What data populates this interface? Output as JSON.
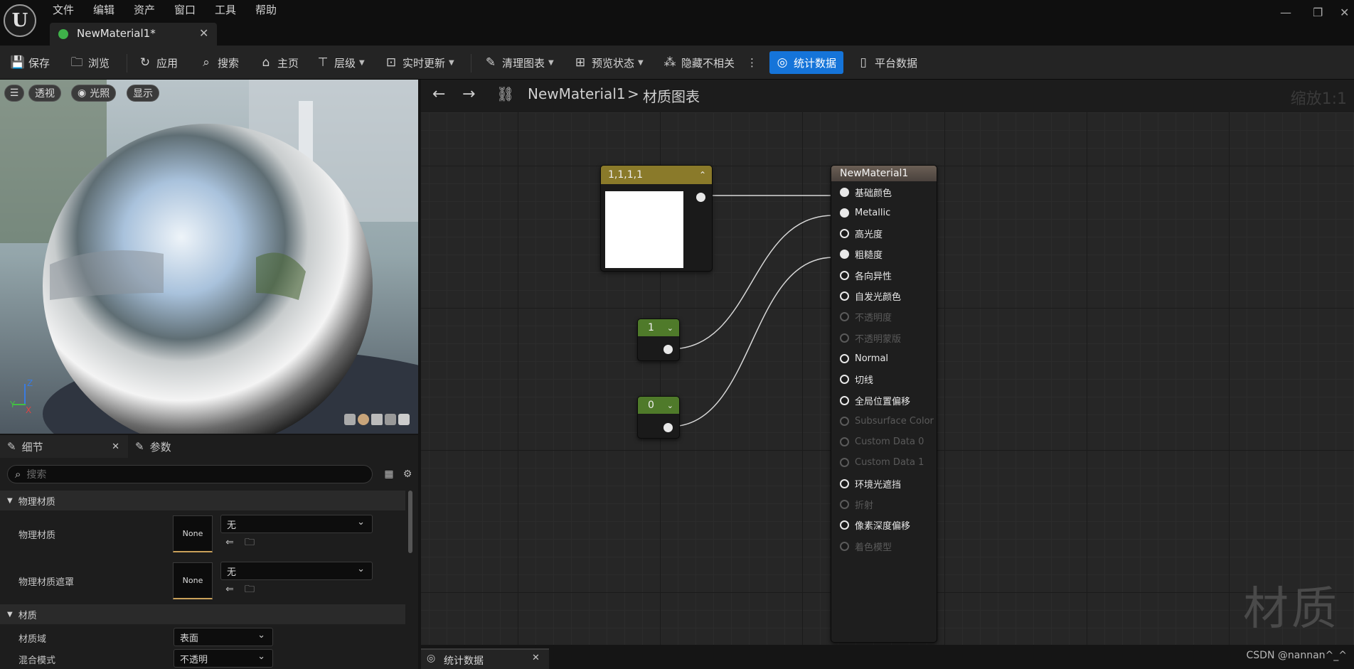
{
  "title_bar": {
    "menus": [
      "文件",
      "编辑",
      "资产",
      "窗口",
      "工具",
      "帮助"
    ],
    "tab_label": "NewMaterial1*",
    "window_controls": [
      "minimize-icon",
      "restore-icon",
      "close-icon"
    ]
  },
  "toolbar": {
    "save": "保存",
    "browse": "浏览",
    "apply": "应用",
    "search": "搜索",
    "home": "主页",
    "hierarchy": "层级",
    "live_update": "实时更新",
    "clean_graph": "清理图表",
    "preview_state": "预览状态",
    "hide_unrelated": "隐藏不相关",
    "stats": "统计数据",
    "platform_stats": "平台数据",
    "accent": "#1574d9"
  },
  "viewport": {
    "perspective": "透视",
    "lighting": "光照",
    "show": "显示",
    "axis_z": "Z",
    "axis_y": "Y",
    "axis_x": "X"
  },
  "details_panel": {
    "tab_details": "细节",
    "tab_params": "参数",
    "search_placeholder": "搜索",
    "cat_physical": "物理材质",
    "row_physical_material": "物理材质",
    "row_physical_mask": "物理材质遮罩",
    "none_thumb": "None",
    "none_dropdown": "无",
    "cat_material": "材质",
    "row_domain": "材质域",
    "domain_value": "表面",
    "row_blend": "混合模式",
    "blend_value": "不透明"
  },
  "graph": {
    "breadcrumb_root": "NewMaterial1",
    "breadcrumb_sep": ">",
    "breadcrumb_leaf": "材质图表",
    "zoom": "缩放1:1",
    "watermark": "材质",
    "constant_node": {
      "title": "1,1,1,1",
      "header_color": "#8a7a2a",
      "swatch_color": "#ffffff"
    },
    "scalar_1": {
      "value": "1",
      "header_color": "#4f7a2a"
    },
    "scalar_0": {
      "value": "0",
      "header_color": "#4f7a2a"
    },
    "material_node": {
      "title": "NewMaterial1",
      "pins": [
        {
          "label": "基础颜色",
          "state": "connected"
        },
        {
          "label": "Metallic",
          "state": "connected"
        },
        {
          "label": "高光度",
          "state": "active"
        },
        {
          "label": "粗糙度",
          "state": "connected"
        },
        {
          "label": "各向异性",
          "state": "active"
        },
        {
          "label": "自发光颜色",
          "state": "active"
        },
        {
          "label": "不透明度",
          "state": "disabled"
        },
        {
          "label": "不透明蒙版",
          "state": "disabled"
        },
        {
          "label": "Normal",
          "state": "active"
        },
        {
          "label": "切线",
          "state": "active"
        },
        {
          "label": "全局位置偏移",
          "state": "active"
        },
        {
          "label": "Subsurface Color",
          "state": "disabled"
        },
        {
          "label": "Custom Data 0",
          "state": "disabled"
        },
        {
          "label": "Custom Data 1",
          "state": "disabled"
        },
        {
          "label": "环境光遮挡",
          "state": "active"
        },
        {
          "label": "折射",
          "state": "disabled"
        },
        {
          "label": "像素深度偏移",
          "state": "active"
        },
        {
          "label": "着色模型",
          "state": "disabled"
        }
      ]
    }
  },
  "bottom_tab": "统计数据",
  "credit": "CSDN @nannan^_^"
}
